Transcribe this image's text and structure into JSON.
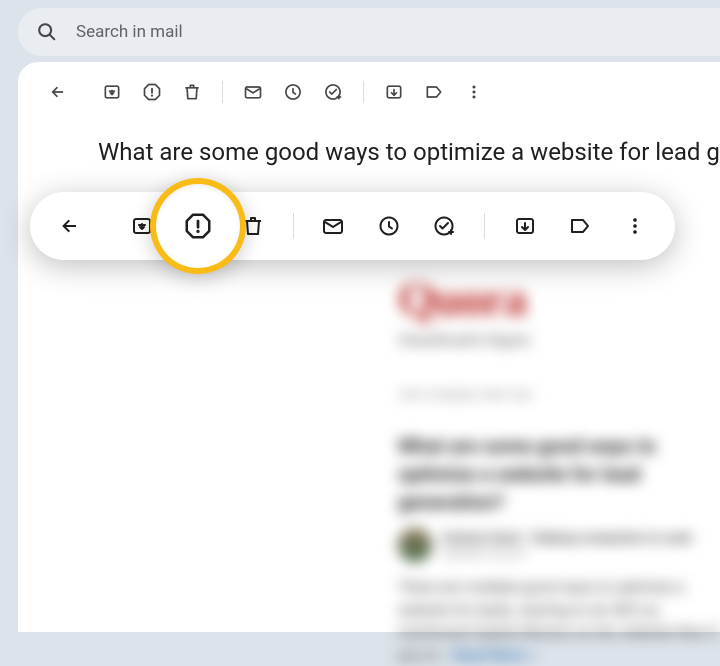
{
  "search": {
    "placeholder": "Search in mail"
  },
  "subject": "What are some good ways to optimize a website for lead generation?",
  "content": {
    "brand": "Quora",
    "subbrand": "CleanEmail's Digest",
    "top_label": "TOP STORIES FOR YOU",
    "story_title": "What are some good ways to optimize a website for lead generation?",
    "author": "Antoine Sarat · Helping companies to scale",
    "date": "updated Aug 26",
    "body": "There are multiple good ways to optimize a website for leads, starting to do SEO as mentioned Sophie Morton on her website then if you m…",
    "read_more": "Read More »"
  },
  "icons": {
    "back": "back-icon",
    "archive": "archive-icon",
    "spam": "report-spam-icon",
    "delete": "delete-icon",
    "unread": "mark-unread-icon",
    "snooze": "snooze-icon",
    "task": "add-task-icon",
    "move": "move-to-inbox-icon",
    "label": "label-icon",
    "more": "more-icon"
  }
}
